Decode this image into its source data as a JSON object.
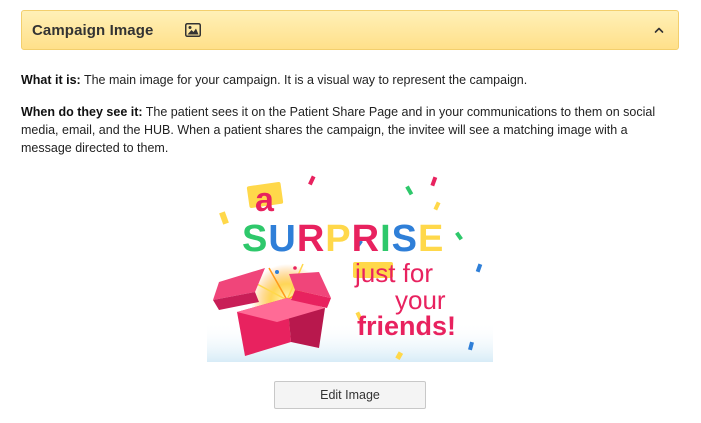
{
  "panel": {
    "title": "Campaign Image",
    "title_icon": "image-icon",
    "collapse_icon": "chevron-up-icon",
    "background": "#ffe08a"
  },
  "what_it_is": {
    "label": "What it is:",
    "text": " The main image for your campaign. It is a visual way to represent the campaign."
  },
  "when_seen": {
    "label": "When do they see it:",
    "text": " The patient sees it on the Patient Share Page and in your communications to them on social media, email, and the HUB. When a patient shares the campaign, the invitee will see a matching image with a message directed to them."
  },
  "image": {
    "line1": "a",
    "line2": "SURPRISE",
    "line3": "just for",
    "line4": "your",
    "line5": "friends!",
    "accent_pink": "#e8225f",
    "accent_yellow": "#ffd84a",
    "accent_green": "#2ec86b",
    "accent_blue": "#2f7fd8"
  },
  "actions": {
    "edit_label": "Edit Image"
  }
}
